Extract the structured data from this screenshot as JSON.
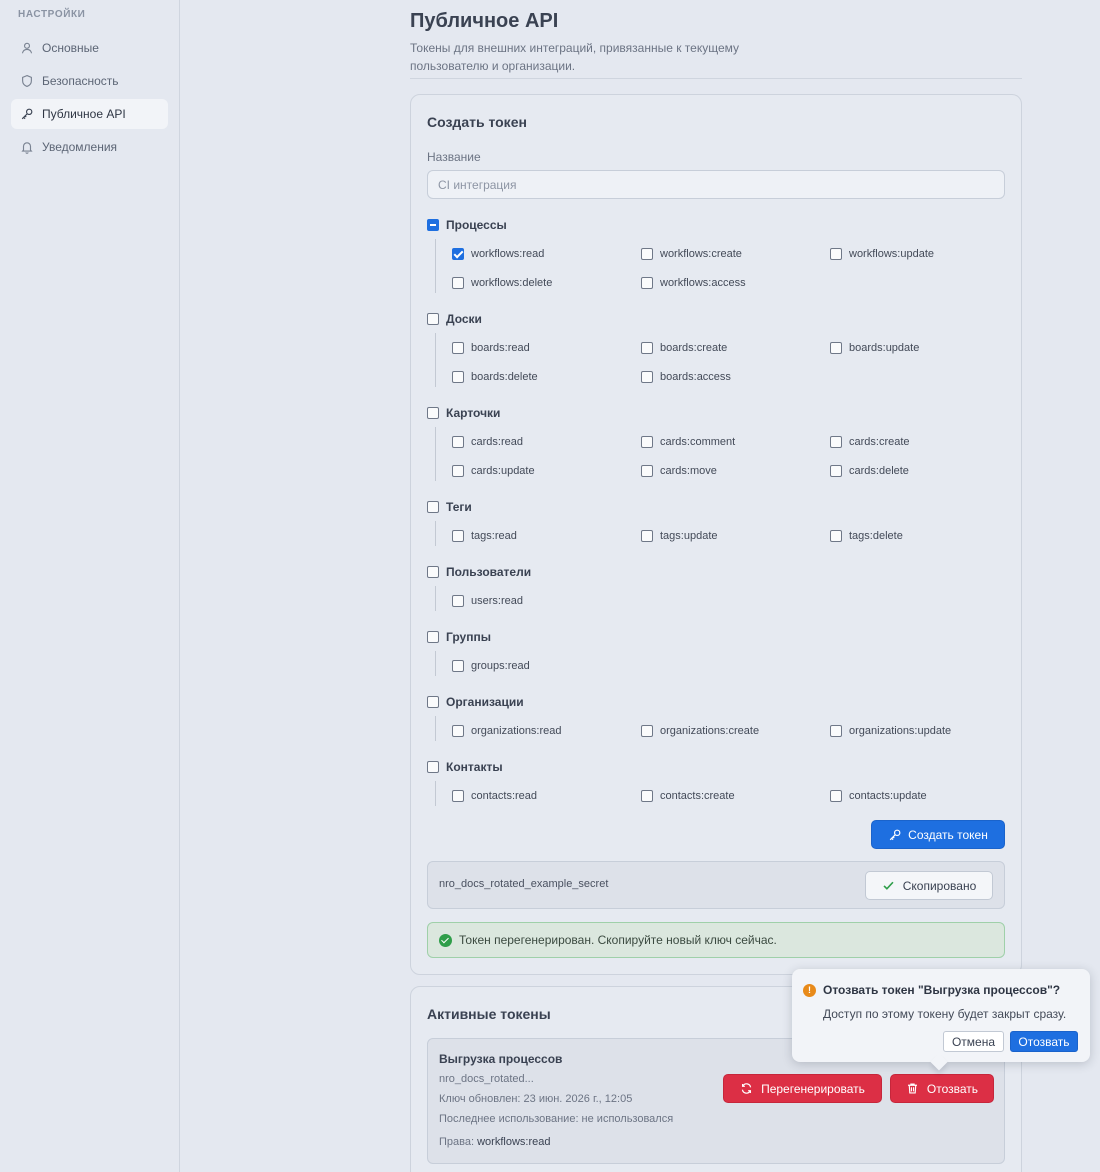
{
  "sidebar": {
    "heading": "НАСТРОЙКИ",
    "items": [
      {
        "label": "Основные",
        "icon": "user-icon",
        "active": false
      },
      {
        "label": "Безопасность",
        "icon": "shield-icon",
        "active": false
      },
      {
        "label": "Публичное API",
        "icon": "key-icon",
        "active": true
      },
      {
        "label": "Уведомления",
        "icon": "bell-icon",
        "active": false
      }
    ]
  },
  "header": {
    "title": "Публичное API",
    "subtitle": "Токены для внешних интеграций, привязанные к текущему пользователю и организации."
  },
  "create": {
    "title": "Создать токен",
    "name_label": "Название",
    "name_placeholder": "CI интеграция",
    "groups": [
      {
        "label": "Процессы",
        "state": "indeterminate",
        "perms": [
          {
            "label": "workflows:read",
            "checked": true
          },
          {
            "label": "workflows:create",
            "checked": false
          },
          {
            "label": "workflows:update",
            "checked": false
          },
          {
            "label": "workflows:delete",
            "checked": false
          },
          {
            "label": "workflows:access",
            "checked": false
          }
        ]
      },
      {
        "label": "Доски",
        "state": "unchecked",
        "perms": [
          {
            "label": "boards:read",
            "checked": false
          },
          {
            "label": "boards:create",
            "checked": false
          },
          {
            "label": "boards:update",
            "checked": false
          },
          {
            "label": "boards:delete",
            "checked": false
          },
          {
            "label": "boards:access",
            "checked": false
          }
        ]
      },
      {
        "label": "Карточки",
        "state": "unchecked",
        "perms": [
          {
            "label": "cards:read",
            "checked": false
          },
          {
            "label": "cards:comment",
            "checked": false
          },
          {
            "label": "cards:create",
            "checked": false
          },
          {
            "label": "cards:update",
            "checked": false
          },
          {
            "label": "cards:move",
            "checked": false
          },
          {
            "label": "cards:delete",
            "checked": false
          }
        ]
      },
      {
        "label": "Теги",
        "state": "unchecked",
        "perms": [
          {
            "label": "tags:read",
            "checked": false
          },
          {
            "label": "tags:update",
            "checked": false
          },
          {
            "label": "tags:delete",
            "checked": false
          }
        ]
      },
      {
        "label": "Пользователи",
        "state": "unchecked",
        "perms": [
          {
            "label": "users:read",
            "checked": false
          }
        ]
      },
      {
        "label": "Группы",
        "state": "unchecked",
        "perms": [
          {
            "label": "groups:read",
            "checked": false
          }
        ]
      },
      {
        "label": "Организации",
        "state": "unchecked",
        "perms": [
          {
            "label": "organizations:read",
            "checked": false
          },
          {
            "label": "organizations:create",
            "checked": false
          },
          {
            "label": "organizations:update",
            "checked": false
          }
        ]
      },
      {
        "label": "Контакты",
        "state": "unchecked",
        "perms": [
          {
            "label": "contacts:read",
            "checked": false
          },
          {
            "label": "contacts:create",
            "checked": false
          },
          {
            "label": "contacts:update",
            "checked": false
          }
        ]
      }
    ],
    "submit_label": "Создать токен",
    "secret_value": "nro_docs_rotated_example_secret",
    "copied_label": "Скопировано",
    "success_message": "Токен перегенерирован. Скопируйте новый ключ сейчас."
  },
  "active": {
    "title": "Активные токены",
    "token": {
      "name": "Выгрузка процессов",
      "prefix": "nro_docs_rotated...",
      "updated": "Ключ обновлен: 23 июн. 2026 г., 12:05",
      "last_used": "Последнее использование: не использовался",
      "perms_label": "Права:",
      "perms_value": "workflows:read",
      "regenerate_label": "Перегенерировать",
      "revoke_label": "Отозвать"
    }
  },
  "popconfirm": {
    "title": "Отозвать токен \"Выгрузка процессов\"?",
    "description": "Доступ по этому токену будет закрыт сразу.",
    "cancel_label": "Отмена",
    "ok_label": "Отозвать"
  },
  "colors": {
    "accent": "#1e6fe0",
    "danger": "#dc2f45",
    "success": "#2f9e4a",
    "warning": "#e88a1a"
  }
}
